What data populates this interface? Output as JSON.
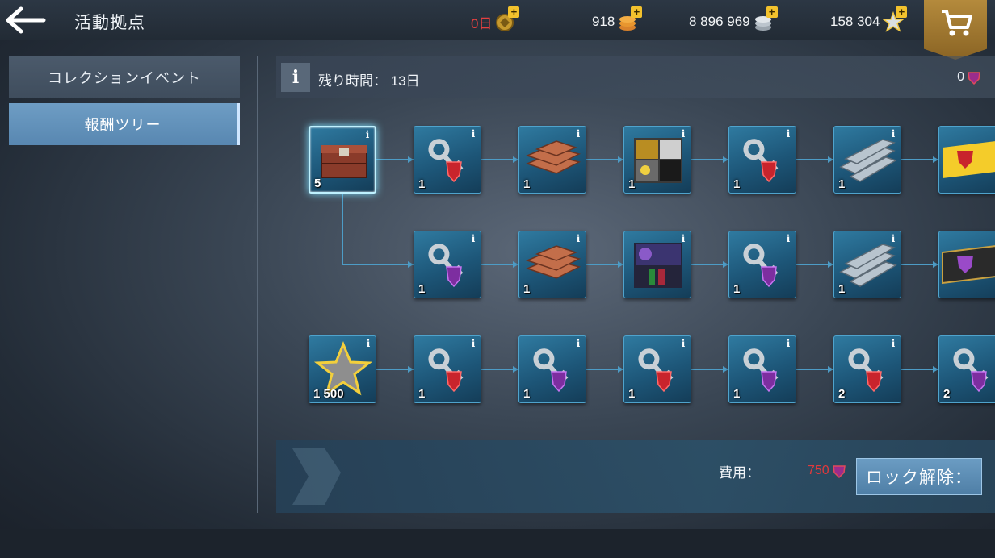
{
  "header": {
    "title": "活動拠点",
    "resources": [
      {
        "name": "days",
        "value": "0日",
        "icon": "medal-icon",
        "color": "#e34040"
      },
      {
        "name": "gold",
        "value": "918",
        "icon": "coins-icon"
      },
      {
        "name": "silver",
        "value": "8 896 969",
        "icon": "silver-coins-icon"
      },
      {
        "name": "stars",
        "value": "158 304",
        "icon": "star-icon"
      }
    ],
    "shop_icon": "cart-icon"
  },
  "sidebar": {
    "tabs": [
      {
        "label": "コレクションイベント",
        "active": false
      },
      {
        "label": "報酬ツリー",
        "active": true
      }
    ]
  },
  "infobar": {
    "info_label": "i",
    "remaining": "残り時間： 13日",
    "token_count": "0"
  },
  "tree": {
    "rows": [
      {
        "nodes": [
          {
            "type": "crate",
            "qty": "5",
            "selected": true
          },
          {
            "type": "key-autobot",
            "qty": "1"
          },
          {
            "type": "copper-ingots",
            "qty": "1"
          },
          {
            "type": "card-pack",
            "qty": "1"
          },
          {
            "type": "key-autobot",
            "qty": "1"
          },
          {
            "type": "steel-beams",
            "qty": "1"
          },
          {
            "type": "autobot-banner",
            "qty": ""
          }
        ]
      },
      {
        "nodes": [
          {
            "type": "key-decepticon",
            "qty": "1"
          },
          {
            "type": "copper-ingots",
            "qty": "1"
          },
          {
            "type": "card-pack-dark",
            "qty": ""
          },
          {
            "type": "key-decepticon",
            "qty": "1"
          },
          {
            "type": "steel-beams",
            "qty": "1"
          },
          {
            "type": "decepticon-banner",
            "qty": ""
          }
        ]
      },
      {
        "nodes": [
          {
            "type": "star",
            "qty": "1 500"
          },
          {
            "type": "key-autobot",
            "qty": "1"
          },
          {
            "type": "key-decepticon",
            "qty": "1"
          },
          {
            "type": "key-autobot",
            "qty": "1"
          },
          {
            "type": "key-decepticon",
            "qty": "1"
          },
          {
            "type": "key-autobot",
            "qty": "2"
          },
          {
            "type": "key-decepticon",
            "qty": "2"
          }
        ]
      }
    ]
  },
  "bottom": {
    "cost_label": "費用：",
    "cost_value": "750",
    "unlock_label": "ロック解除："
  }
}
